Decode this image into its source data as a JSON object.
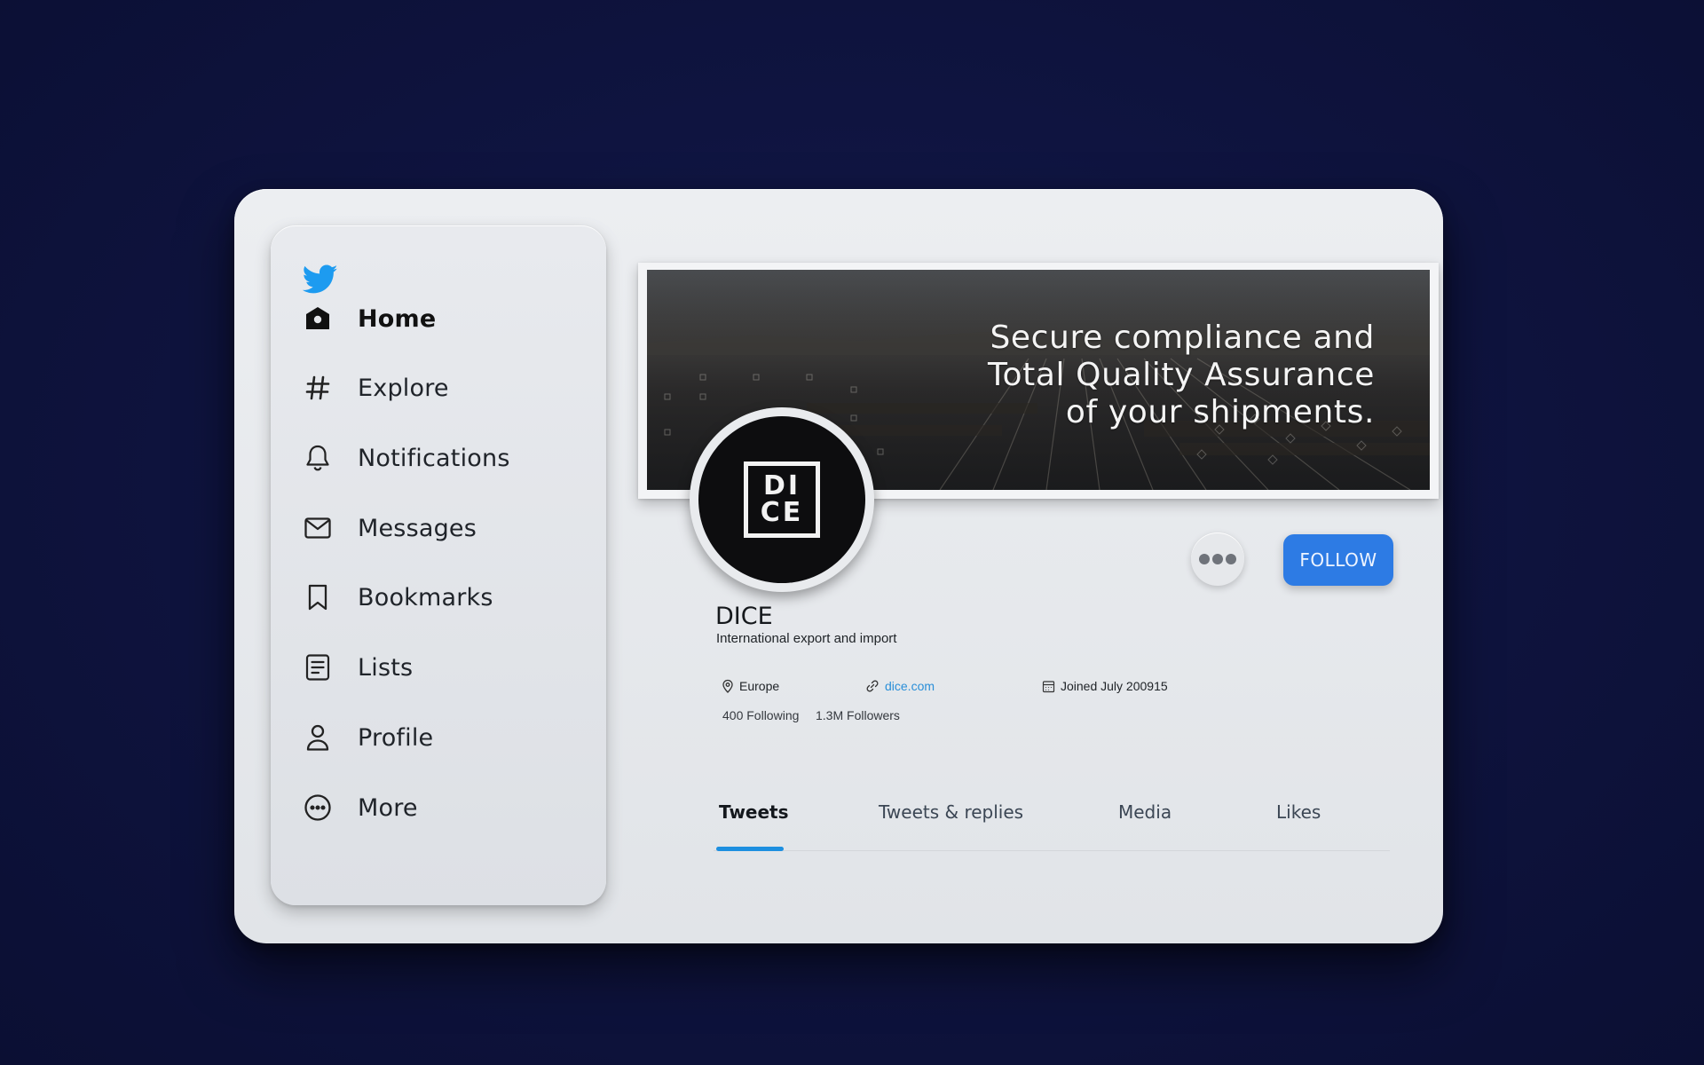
{
  "sidebar": {
    "logo_icon": "twitter-bird-icon",
    "accent_color": "#1d9bf0",
    "items": [
      {
        "label": "Home",
        "icon": "home-icon",
        "active": true
      },
      {
        "label": "Explore",
        "icon": "hashtag-icon"
      },
      {
        "label": "Notifications",
        "icon": "bell-icon"
      },
      {
        "label": "Messages",
        "icon": "mail-icon"
      },
      {
        "label": "Bookmarks",
        "icon": "bookmark-icon"
      },
      {
        "label": "Lists",
        "icon": "list-icon"
      },
      {
        "label": "Profile",
        "icon": "person-icon"
      },
      {
        "label": "More",
        "icon": "more-circle-icon"
      }
    ]
  },
  "banner": {
    "lines": [
      "Secure compliance and",
      "Total Quality Assurance",
      "of your shipments."
    ]
  },
  "profile": {
    "avatar_letters": [
      "DI",
      "CE"
    ],
    "name": "DICE",
    "bio": "International export and import",
    "location": "Europe",
    "website": "dice.com",
    "joined": "Joined July 200915",
    "following": "400 Following",
    "followers": "1.3M Followers"
  },
  "actions": {
    "more_icon": "ellipsis-icon",
    "follow_label": "FOLLOW",
    "follow_color": "#2d7be4"
  },
  "tabs": [
    {
      "label": "Tweets",
      "active": true
    },
    {
      "label": "Tweets & replies"
    },
    {
      "label": "Media"
    },
    {
      "label": "Likes"
    }
  ]
}
